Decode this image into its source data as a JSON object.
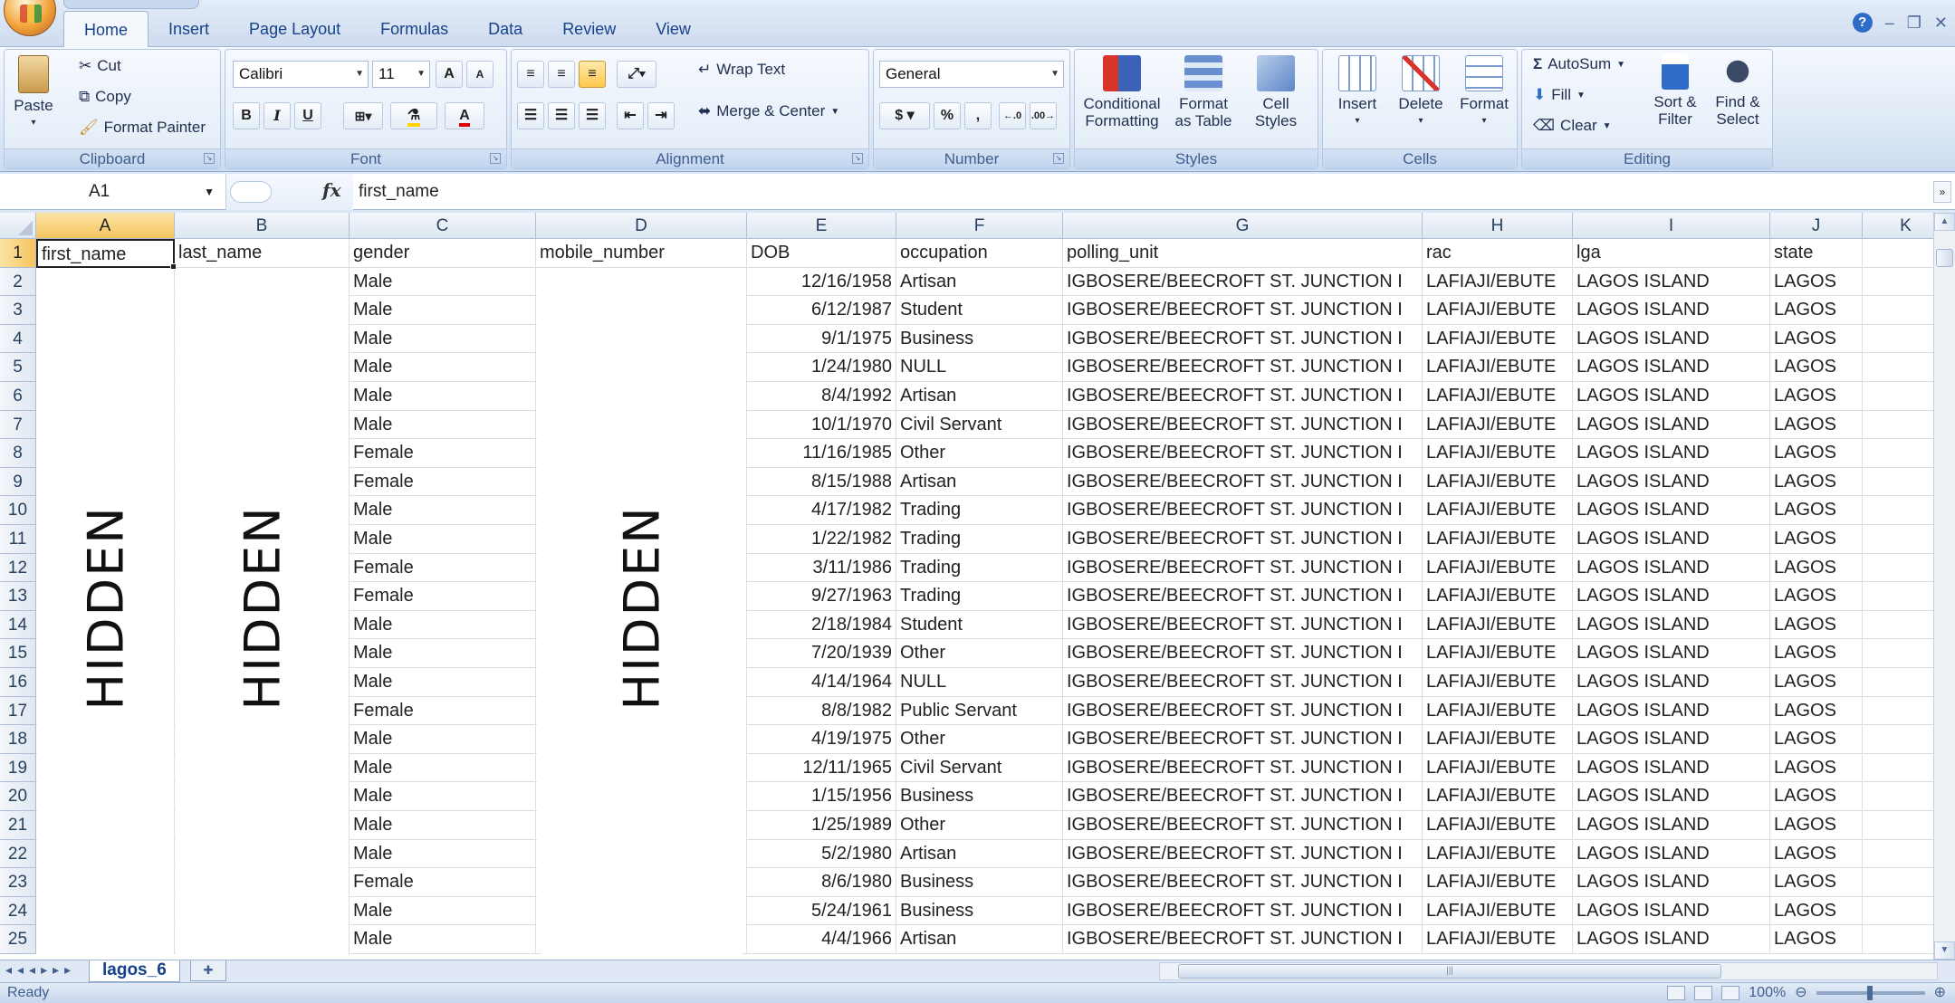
{
  "ribbon": {
    "tabs": [
      "Home",
      "Insert",
      "Page Layout",
      "Formulas",
      "Data",
      "Review",
      "View"
    ],
    "active_tab": "Home",
    "clipboard": {
      "paste": "Paste",
      "cut": "Cut",
      "copy": "Copy",
      "format_painter": "Format Painter",
      "label": "Clipboard"
    },
    "font": {
      "name": "Calibri",
      "size": "11",
      "label": "Font",
      "bold": "B",
      "italic": "I",
      "underline": "U",
      "grow": "A",
      "shrink": "A",
      "font_color": "A"
    },
    "alignment": {
      "wrap_text": "Wrap Text",
      "merge_center": "Merge & Center",
      "label": "Alignment"
    },
    "number": {
      "format": "General",
      "currency": "$",
      "percent": "%",
      "comma": ",",
      "label": "Number"
    },
    "styles": {
      "conditional": "Conditional Formatting",
      "format_table": "Format as Table",
      "cell_styles": "Cell Styles",
      "label": "Styles"
    },
    "cells": {
      "insert": "Insert",
      "delete": "Delete",
      "format": "Format",
      "label": "Cells"
    },
    "editing": {
      "autosum": "AutoSum",
      "fill": "Fill",
      "clear": "Clear",
      "sort_filter": "Sort & Filter",
      "find_select": "Find & Select",
      "label": "Editing",
      "sigma": "Σ"
    }
  },
  "formula_bar": {
    "name_box": "A1",
    "fx": "fx",
    "value": "first_name"
  },
  "grid": {
    "columns": [
      "A",
      "B",
      "C",
      "D",
      "E",
      "F",
      "G",
      "H",
      "I",
      "J",
      "K"
    ],
    "headers": [
      "first_name",
      "last_name",
      "gender",
      "mobile_number",
      "DOB",
      "occupation",
      "polling_unit",
      "rac",
      "lga",
      "state",
      ""
    ],
    "row_numbers": [
      1,
      2,
      3,
      4,
      5,
      6,
      7,
      8,
      9,
      10,
      11,
      12,
      13,
      14,
      15,
      16,
      17,
      18,
      19,
      20,
      21,
      22,
      23,
      24,
      25
    ],
    "rows": [
      {
        "gender": "Male",
        "DOB": "12/16/1958",
        "occupation": "Artisan"
      },
      {
        "gender": "Male",
        "DOB": "6/12/1987",
        "occupation": "Student"
      },
      {
        "gender": "Male",
        "DOB": "9/1/1975",
        "occupation": "Business"
      },
      {
        "gender": "Male",
        "DOB": "1/24/1980",
        "occupation": "NULL"
      },
      {
        "gender": "Male",
        "DOB": "8/4/1992",
        "occupation": "Artisan"
      },
      {
        "gender": "Male",
        "DOB": "10/1/1970",
        "occupation": "Civil Servant"
      },
      {
        "gender": "Female",
        "DOB": "11/16/1985",
        "occupation": "Other"
      },
      {
        "gender": "Female",
        "DOB": "8/15/1988",
        "occupation": "Artisan"
      },
      {
        "gender": "Male",
        "DOB": "4/17/1982",
        "occupation": "Trading"
      },
      {
        "gender": "Male",
        "DOB": "1/22/1982",
        "occupation": "Trading"
      },
      {
        "gender": "Female",
        "DOB": "3/11/1986",
        "occupation": "Trading"
      },
      {
        "gender": "Female",
        "DOB": "9/27/1963",
        "occupation": "Trading"
      },
      {
        "gender": "Male",
        "DOB": "2/18/1984",
        "occupation": "Student"
      },
      {
        "gender": "Male",
        "DOB": "7/20/1939",
        "occupation": "Other"
      },
      {
        "gender": "Male",
        "DOB": "4/14/1964",
        "occupation": "NULL"
      },
      {
        "gender": "Female",
        "DOB": "8/8/1982",
        "occupation": "Public Servant"
      },
      {
        "gender": "Male",
        "DOB": "4/19/1975",
        "occupation": "Other"
      },
      {
        "gender": "Male",
        "DOB": "12/11/1965",
        "occupation": "Civil Servant"
      },
      {
        "gender": "Male",
        "DOB": "1/15/1956",
        "occupation": "Business"
      },
      {
        "gender": "Male",
        "DOB": "1/25/1989",
        "occupation": "Other"
      },
      {
        "gender": "Male",
        "DOB": "5/2/1980",
        "occupation": "Artisan"
      },
      {
        "gender": "Female",
        "DOB": "8/6/1980",
        "occupation": "Business"
      },
      {
        "gender": "Male",
        "DOB": "5/24/1961",
        "occupation": "Business"
      },
      {
        "gender": "Male",
        "DOB": "4/4/1966",
        "occupation": "Artisan"
      }
    ],
    "constant_values": {
      "polling_unit": "IGBOSERE/BEECROFT ST. JUNCTION I",
      "rac": "LAFIAJI/EBUTE",
      "lga": "LAGOS ISLAND",
      "state": "LAGOS"
    },
    "hidden_label": "HIDDEN"
  },
  "sheets": {
    "active": "lagos_6"
  },
  "status": {
    "left": "Ready",
    "zoom": "100%"
  }
}
